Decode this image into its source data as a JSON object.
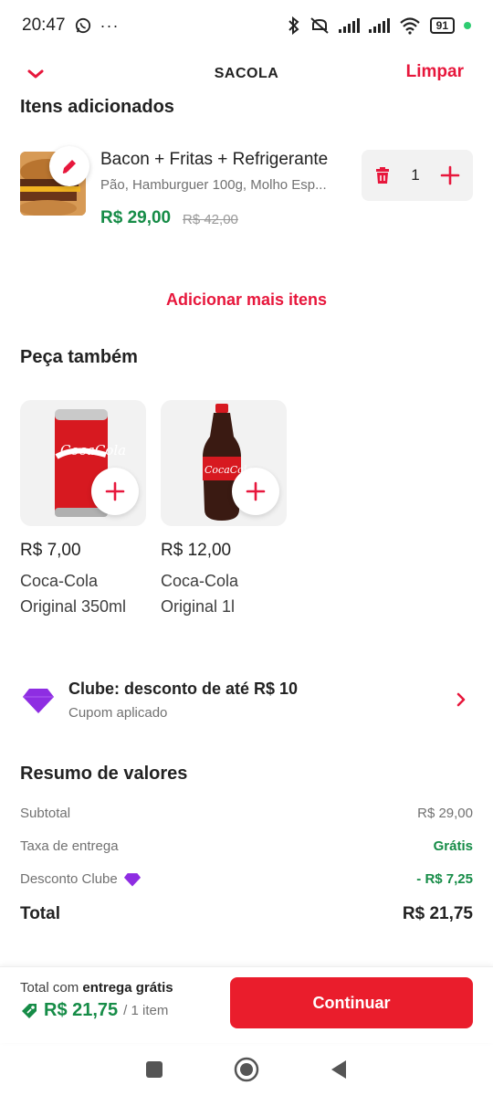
{
  "status_bar": {
    "time": "20:47",
    "battery": "91"
  },
  "header": {
    "title": "SACOLA",
    "clear_label": "Limpar"
  },
  "cart": {
    "section_title": "Itens adicionados",
    "item": {
      "name": "Bacon + Fritas + Refrigerante",
      "description": "Pão, Hamburguer 100g, Molho Esp...",
      "price": "R$ 29,00",
      "old_price": "R$ 42,00",
      "quantity": "1"
    },
    "add_more_label": "Adicionar mais itens"
  },
  "suggestions": {
    "title": "Peça também",
    "items": [
      {
        "price": "R$ 7,00",
        "name_line1": "Coca-Cola",
        "name_line2": "Original 350ml"
      },
      {
        "price": "R$ 12,00",
        "name_line1": "Coca-Cola",
        "name_line2": "Original 1l"
      }
    ]
  },
  "clube": {
    "title": "Clube: desconto de até R$ 10",
    "subtitle": "Cupom aplicado"
  },
  "summary": {
    "title": "Resumo de valores",
    "subtotal_label": "Subtotal",
    "subtotal_value": "R$ 29,00",
    "delivery_label": "Taxa de entrega",
    "delivery_value": "Grátis",
    "discount_label": "Desconto Clube",
    "discount_value": "- R$ 7,25",
    "total_label": "Total",
    "total_value": "R$ 21,75"
  },
  "footer": {
    "total_prefix": "Total com",
    "total_bold": "entrega grátis",
    "amount": "R$ 21,75",
    "count": "/ 1 item",
    "continue_label": "Continuar"
  },
  "colors": {
    "brand_red": "#ea1d2c",
    "price_green": "#168c47",
    "clube_purple": "#8e2de2"
  }
}
